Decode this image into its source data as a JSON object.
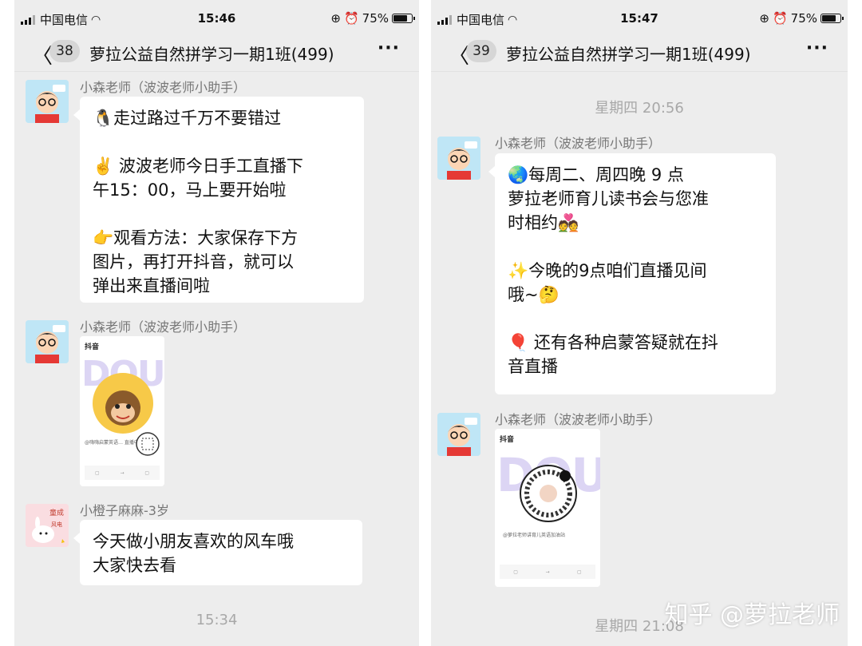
{
  "left": {
    "status": {
      "carrier": "中国电信",
      "time": "15:46",
      "battery": "75%",
      "battery_level": 0.75
    },
    "nav": {
      "back_icon": "chevron-left-icon",
      "unread": "38",
      "title": "萝拉公益自然拼学习一期1班(499)",
      "more": "···"
    },
    "messages": [
      {
        "sender": "小森老师（波波老师小助手）",
        "paragraphs": [
          "🐧走过路过千万不要错过",
          "✌️ 波波老师今日手工直播下\n午15：00，马上要开始啦",
          "👉观看方法：大家保存下方\n图片，再打开抖音，就可以\n弹出来直播间啦"
        ]
      },
      {
        "sender": "小森老师（波波老师小助手）",
        "image": {
          "app": "抖音",
          "bg_word": "DOU",
          "badge_text": "嗨嗨启蒙英语",
          "caption": "@嗨嗨启蒙英语…  直播中"
        }
      },
      {
        "sender": "小橙子麻麻-3岁",
        "paragraphs": [
          "今天做小朋友喜欢的风车哦\n大家快去看"
        ]
      }
    ],
    "timestamp": "15:34"
  },
  "right": {
    "status": {
      "carrier": "中国电信",
      "time": "15:47",
      "battery": "75%",
      "battery_level": 0.75
    },
    "nav": {
      "back_icon": "chevron-left-icon",
      "unread": "39",
      "title": "萝拉公益自然拼学习一期1班(499)",
      "more": "···"
    },
    "timestamp_top": "星期四 20:56",
    "messages": [
      {
        "sender": "小森老师（波波老师小助手）",
        "paragraphs": [
          "🌏每周二、周四晚 9 点\n萝拉老师育儿读书会与您准\n时相约💑",
          "✨今晚的9点咱们直播见间\n哦~🤔",
          "🎈 还有各种启蒙答疑就在抖\n音直播"
        ]
      },
      {
        "sender": "小森老师（波波老师小助手）",
        "image": {
          "app": "抖音",
          "bg_word": "DOU",
          "caption": "@萝拉老师讲育儿英语加油站"
        }
      }
    ],
    "timestamp_bottom": "星期四 21:08"
  },
  "watermark": "知乎 @萝拉老师"
}
